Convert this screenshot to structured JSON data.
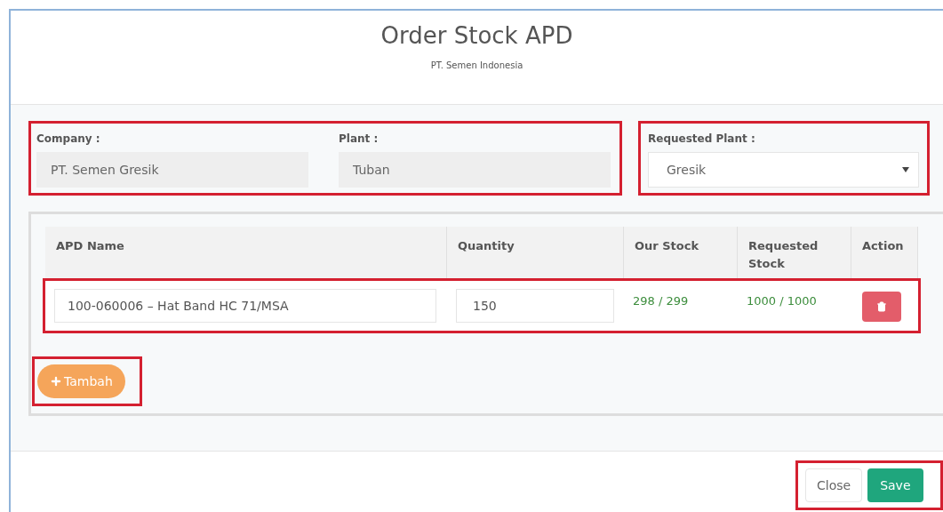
{
  "header": {
    "title": "Order Stock APD",
    "subtitle": "PT. Semen Indonesia"
  },
  "fields": [
    {
      "label": "Company :",
      "value": "PT. Semen Gresik"
    },
    {
      "label": "Plant :",
      "value": "Tuban"
    }
  ],
  "requested_plant": {
    "label": "Requested Plant :",
    "value": "Gresik"
  },
  "table": {
    "columns": [
      "APD Name",
      "Quantity",
      "Our Stock",
      "Requested Stock",
      "Action"
    ],
    "rows": [
      {
        "apd_name": "100-060006 – Hat Band HC 71/MSA",
        "quantity": "150",
        "our_stock": "298 / 299",
        "requested_stock": "1000 / 1000"
      }
    ]
  },
  "add_button": "Tambah",
  "footer_buttons": [
    {
      "label": "Close",
      "kind": "default"
    },
    {
      "label": "Save",
      "kind": "primary"
    }
  ]
}
